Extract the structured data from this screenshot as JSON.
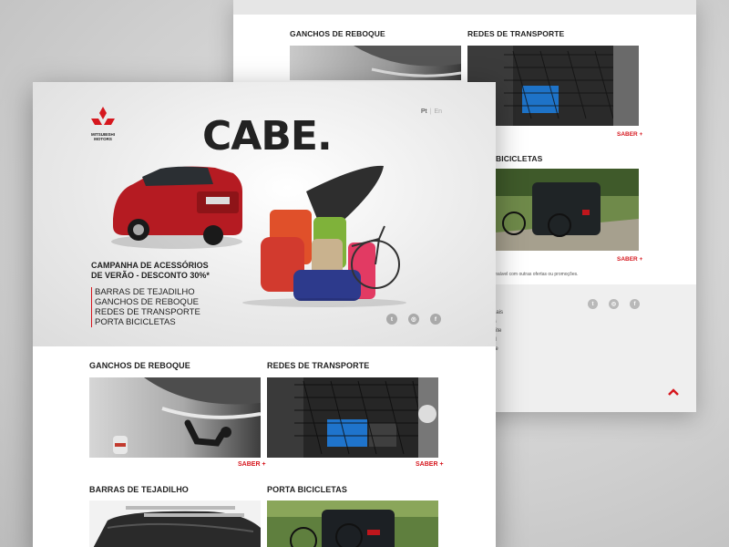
{
  "back_page": {
    "col1_title": "GANCHOS DE REBOQUE",
    "col2_title": "REDES DE TRANSPORTE",
    "col2_row2_title": "BICICLETAS",
    "saber_label": "SABER +",
    "legal_text": "onsável com outras ofertas ou promoções.",
    "footer_links": [
      "ciais",
      "ts",
      "Site",
      "al",
      "de"
    ],
    "social_icons": [
      "twitter-icon",
      "instagram-icon",
      "facebook-icon"
    ]
  },
  "front_page": {
    "logo_text_1": "MITSUBISHI",
    "logo_text_2": "MOTORS",
    "lang_active": "Pt",
    "lang_separator": "|",
    "lang_inactive": "En",
    "headline": "CABE.",
    "campaign_line_1": "CAMPANHA DE ACESSÓRIOS",
    "campaign_line_2": "DE VERÃO - DESCONTO 30%*",
    "menu_items": [
      "BARRAS DE TEJADILHO",
      "GANCHOS DE REBOQUE",
      "REDES DE TRANSPORTE",
      "PORTA BICICLETAS"
    ],
    "social_icons": [
      "twitter-icon",
      "instagram-icon",
      "facebook-icon"
    ],
    "products": [
      {
        "title": "GANCHOS DE REBOQUE",
        "cta": "SABER +"
      },
      {
        "title": "REDES DE TRANSPORTE",
        "cta": "SABER +"
      },
      {
        "title": "BARRAS DE TEJADILHO"
      },
      {
        "title": "PORTA BICICLETAS"
      }
    ]
  },
  "colors": {
    "brand_red": "#d6171e",
    "text_dark": "#222222",
    "hero_bg": "#e4e4e4"
  }
}
